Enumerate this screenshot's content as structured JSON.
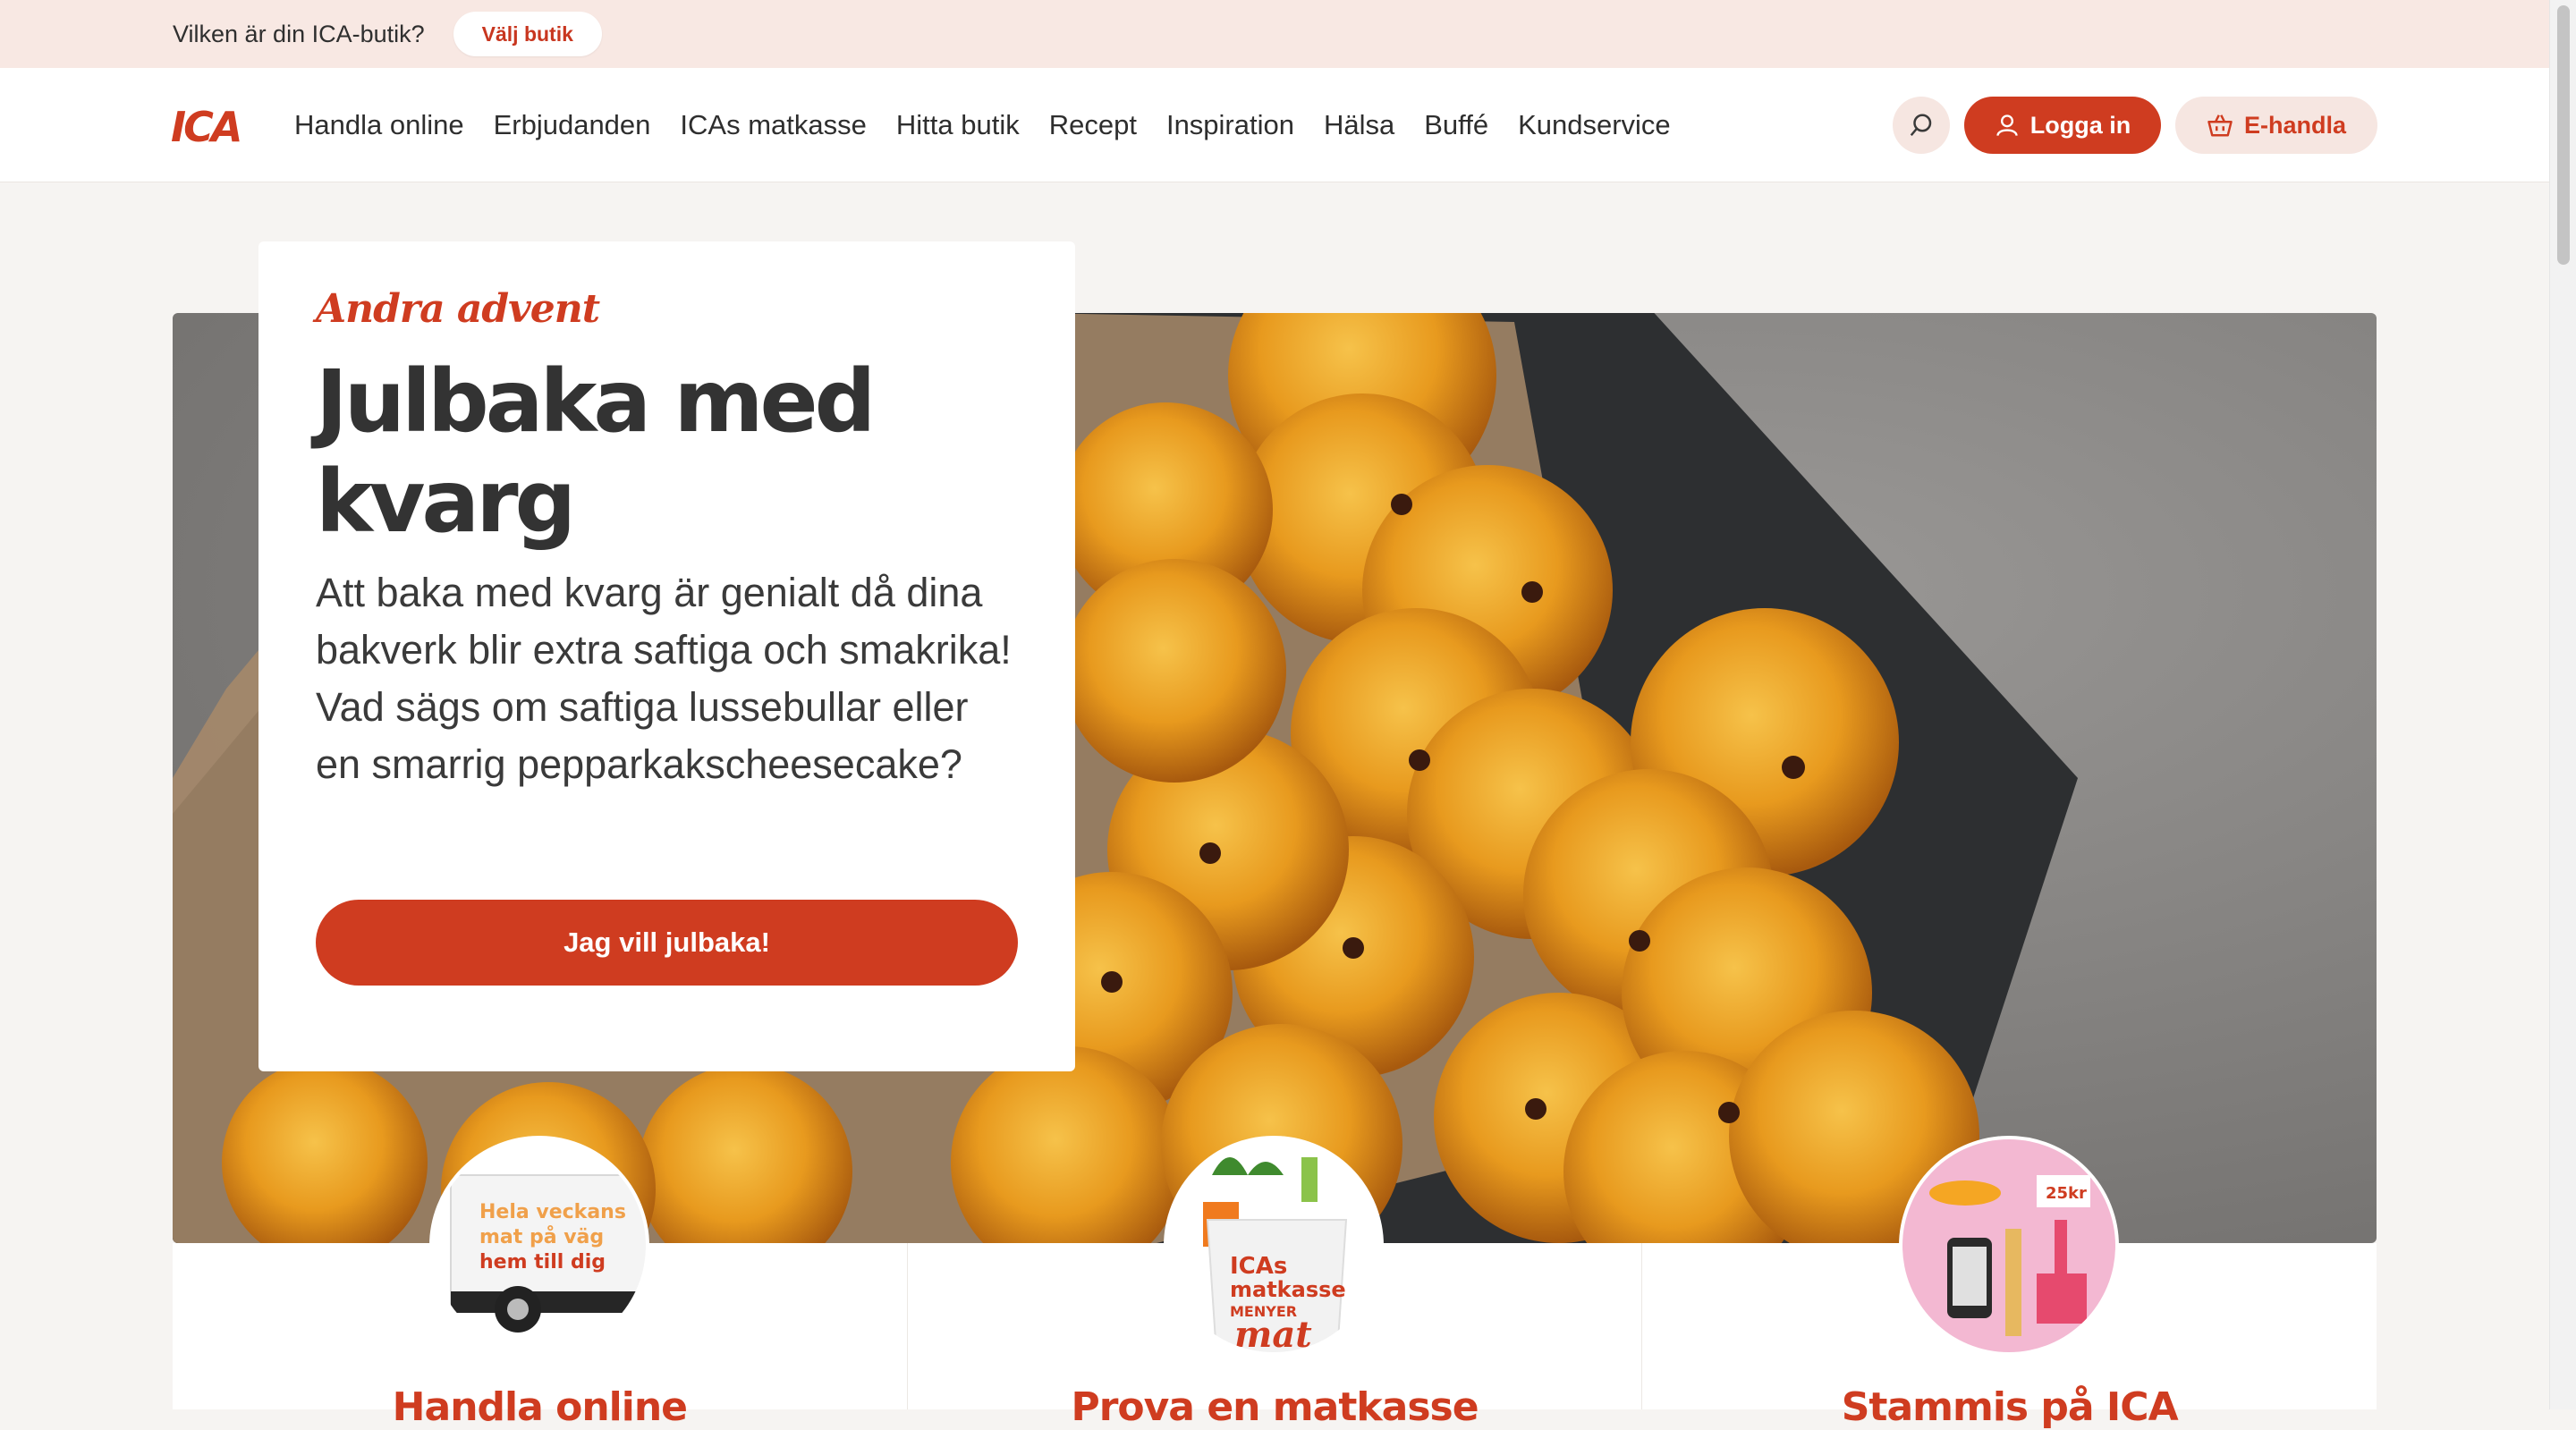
{
  "storebar": {
    "question": "Vilken är din ICA-butik?",
    "button": "Välj butik"
  },
  "header": {
    "logo": "ICA",
    "nav": [
      "Handla online",
      "Erbjudanden",
      "ICAs matkasse",
      "Hitta butik",
      "Recept",
      "Inspiration",
      "Hälsa",
      "Buffé",
      "Kundservice"
    ],
    "login": "Logga in",
    "ehandla": "E-handla"
  },
  "hero": {
    "kicker": "Andra advent",
    "title_line1": "Julbaka med",
    "title_line2": "kvarg",
    "text": "Att baka med kvarg är genialt då dina bakverk blir extra saftiga och smakrika! Vad sägs om saftiga lussebullar eller en smarrig pepparkakscheesecake?",
    "cta": "Jag vill julbaka!"
  },
  "cards": [
    {
      "title": "Handla online",
      "image_text": [
        "Hela veckans",
        "mat på väg",
        "hem till dig"
      ]
    },
    {
      "title": "Prova en matkasse",
      "image_text": [
        "ICAs",
        "matkasse",
        "MENYER",
        "mat"
      ]
    },
    {
      "title": "Stammis på ICA",
      "image_text": [
        "25kr"
      ]
    }
  ],
  "colors": {
    "brand_red": "#cf3c20",
    "store_bar_bg": "#f8e8e3",
    "pill_bg": "#f6e6e1"
  }
}
